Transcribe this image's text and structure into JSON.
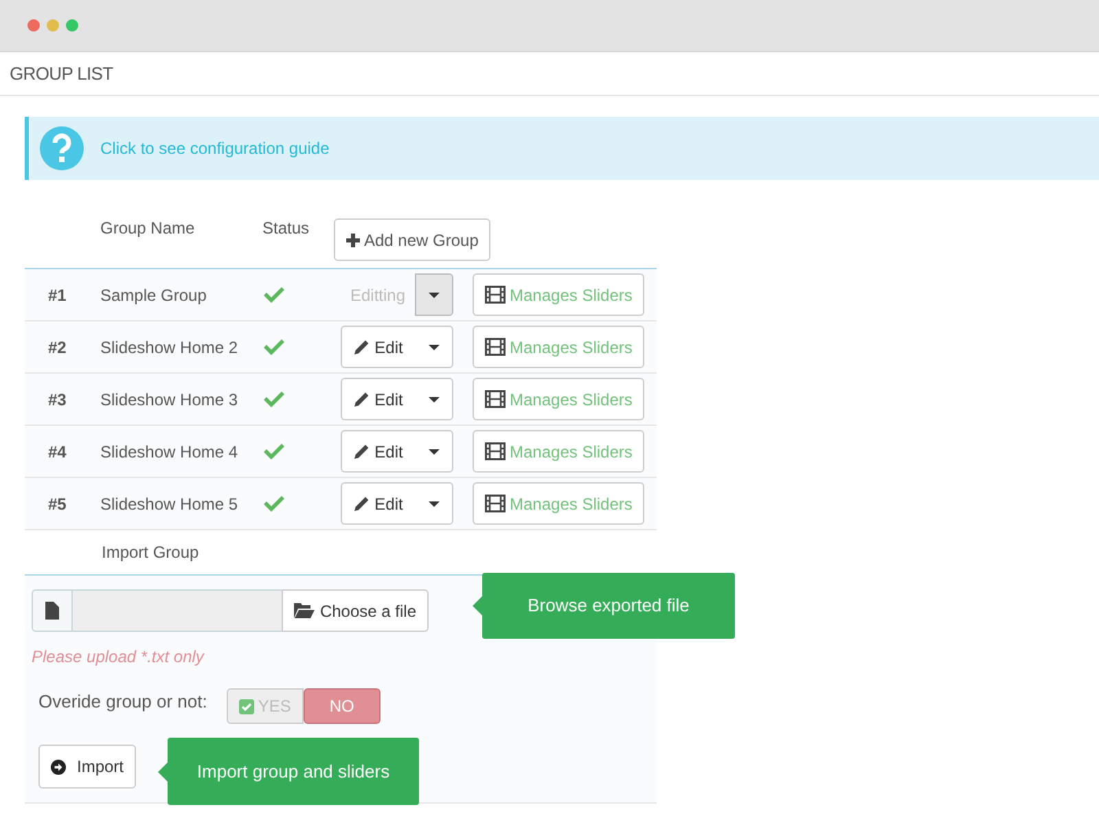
{
  "page_title": "GROUP LIST",
  "guide_link": "Click to see configuration guide",
  "table": {
    "columns": [
      "Group Name",
      "Status"
    ],
    "add_button": "Add new Group",
    "rows": [
      {
        "number": "#1",
        "name": "Sample Group",
        "active": true,
        "editing": true,
        "edit_label": "Editting",
        "manage_label": "Manages Sliders"
      },
      {
        "number": "#2",
        "name": "Slideshow Home 2",
        "active": true,
        "editing": false,
        "edit_label": "Edit",
        "manage_label": "Manages Sliders"
      },
      {
        "number": "#3",
        "name": "Slideshow Home 3",
        "active": true,
        "editing": false,
        "edit_label": "Edit",
        "manage_label": "Manages Sliders"
      },
      {
        "number": "#4",
        "name": "Slideshow Home 4",
        "active": true,
        "editing": false,
        "edit_label": "Edit",
        "manage_label": "Manages Sliders"
      },
      {
        "number": "#5",
        "name": "Slideshow Home 5",
        "active": true,
        "editing": false,
        "edit_label": "Edit",
        "manage_label": "Manages Sliders"
      }
    ]
  },
  "import": {
    "heading": "Import Group",
    "choose_button": "Choose a file",
    "hint": "Please upload *.txt only",
    "override_label": "Overide group or not:",
    "toggle": [
      {
        "label": "YES",
        "selected": false
      },
      {
        "label": "NO",
        "selected": true
      }
    ],
    "import_button": "Import"
  },
  "callouts": [
    "Browse exported file",
    "Import group and sliders"
  ]
}
